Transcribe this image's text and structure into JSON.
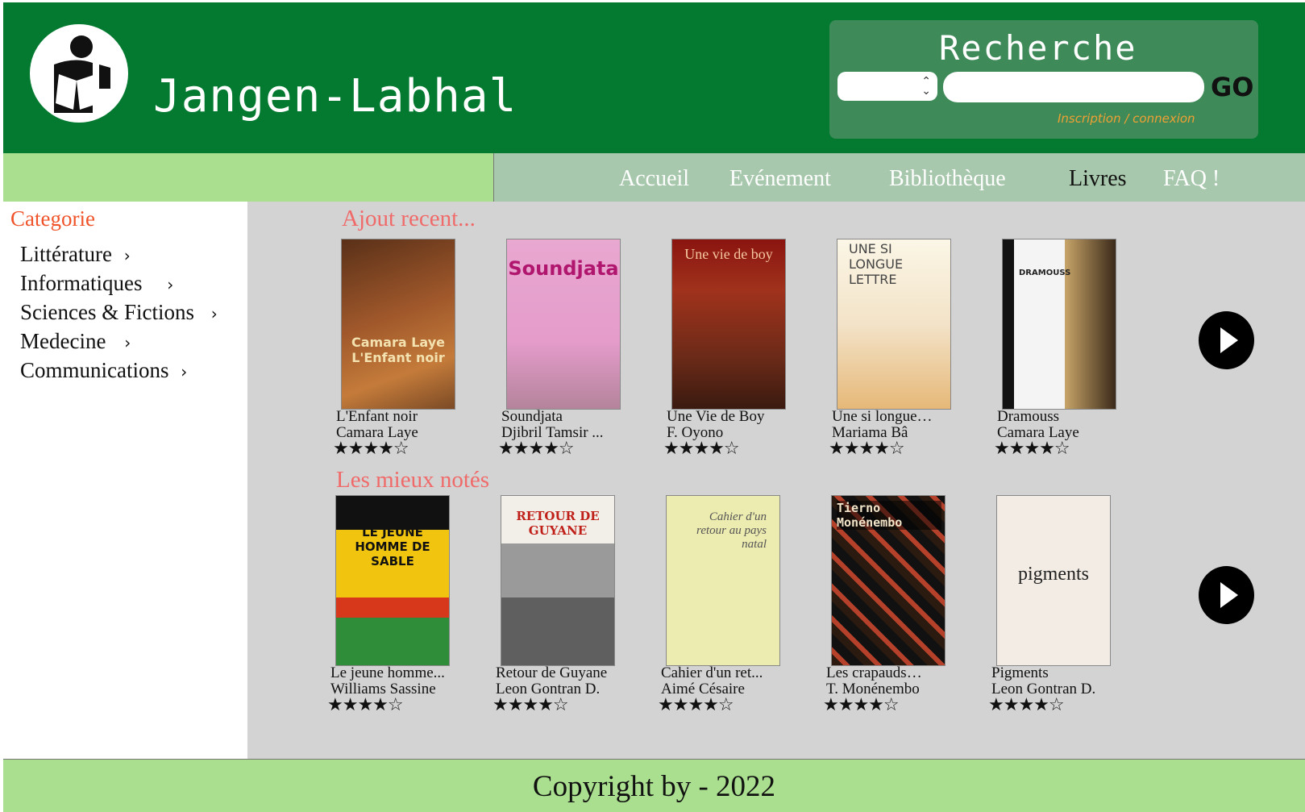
{
  "header": {
    "site_title": "Jangen-Labhal",
    "logo_icon": "reader-icon",
    "search": {
      "title": "Recherche",
      "select_value": "",
      "input_value": "",
      "go_label": "GO",
      "auth_link": "Inscription / connexion"
    }
  },
  "nav": {
    "items": [
      {
        "label": "Accueil"
      },
      {
        "label": "Evénement"
      },
      {
        "label": "Bibliothèque"
      },
      {
        "label": "Livres"
      },
      {
        "label": "FAQ !"
      }
    ]
  },
  "sidebar": {
    "title": "Categorie",
    "items": [
      {
        "label": "Littérature",
        "arrow": "›"
      },
      {
        "label": "Informatiques",
        "arrow": "›"
      },
      {
        "label": "Sciences & Fictions",
        "arrow": "›"
      },
      {
        "label": "Medecine",
        "arrow": "›"
      },
      {
        "label": "Communications",
        "arrow": "›"
      }
    ]
  },
  "sections": {
    "recent": {
      "title": "Ajout recent...",
      "books": [
        {
          "title": "L'Enfant noir",
          "author": "Camara Laye",
          "stars": "★★★★☆",
          "rating": 4,
          "cover_text": "Camara Laye\nL'Enfant noir"
        },
        {
          "title": "Soundjata",
          "author": "Djibril Tamsir ...",
          "stars": "★★★★☆",
          "rating": 4,
          "cover_text": "Soundjata"
        },
        {
          "title": "Une Vie de Boy",
          "author": "F. Oyono",
          "stars": "★★★★☆",
          "rating": 4,
          "cover_text": "Une vie de boy"
        },
        {
          "title": "Une si longue…",
          "author": "Mariama Bâ",
          "stars": "★★★★☆",
          "rating": 4,
          "cover_text": "UNE SI LONGUE LETTRE"
        },
        {
          "title": "Dramouss",
          "author": "Camara Laye",
          "stars": "★★★★☆",
          "rating": 4,
          "cover_text": "DRAMOUSS"
        }
      ]
    },
    "top_rated": {
      "title": "Les mieux notés",
      "books": [
        {
          "title": "Le jeune homme...",
          "author": "Williams Sassine",
          "stars": "★★★★☆",
          "rating": 4,
          "cover_text": "LE JEUNE HOMME DE SABLE"
        },
        {
          "title": "Retour de Guyane",
          "author": "Leon Gontran D.",
          "stars": "★★★★☆",
          "rating": 4,
          "cover_text": "RETOUR DE GUYANE"
        },
        {
          "title": "Cahier d'un ret...",
          "author": "Aimé Césaire",
          "stars": "★★★★☆",
          "rating": 4,
          "cover_text": "Cahier d'un retour au pays natal"
        },
        {
          "title": "Les crapauds…",
          "author": "T. Monénembo",
          "stars": "★★★★☆",
          "rating": 4,
          "cover_text": "Tierno Monénembo"
        },
        {
          "title": "Pigments",
          "author": "Leon Gontran D.",
          "stars": "★★★★☆",
          "rating": 4,
          "cover_text": "pigments"
        }
      ]
    }
  },
  "footer": {
    "text": "Copyright by - 2022"
  },
  "colors": {
    "header_bg": "#037a30",
    "search_bg": "#3f8a59",
    "nav_left_bg": "#a9df8e",
    "nav_right_bg": "#a7c8ac",
    "main_bg": "#d3d3d3",
    "category_title": "#f0532a",
    "section_title": "#f06a6a",
    "auth_link": "#f0a033"
  }
}
